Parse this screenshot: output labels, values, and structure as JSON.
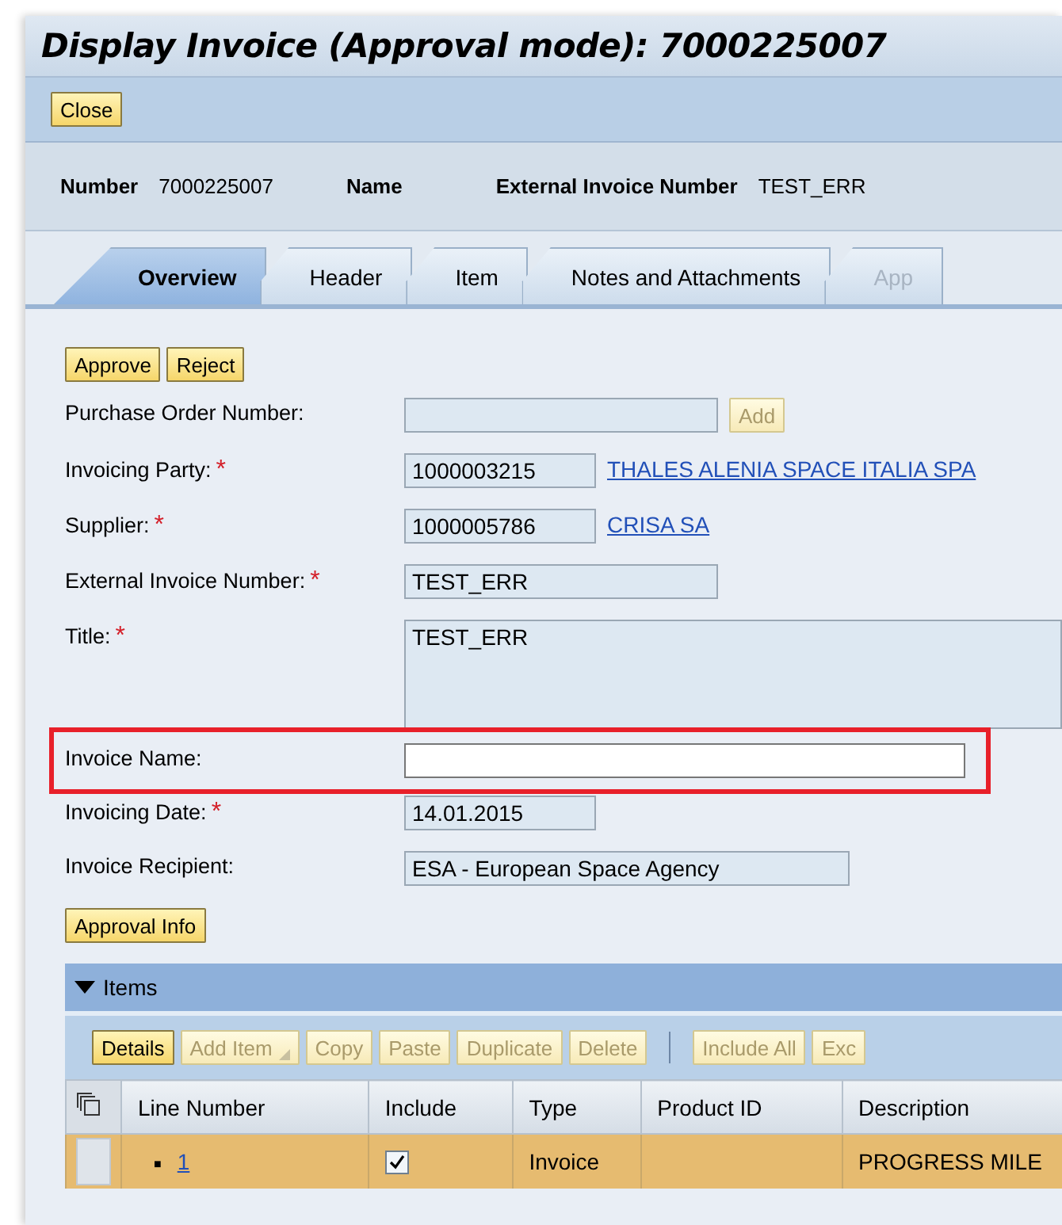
{
  "window": {
    "title": "Display Invoice (Approval mode): 7000225007"
  },
  "toolbar": {
    "buttons": [
      "Close"
    ]
  },
  "header_info": [
    {
      "label": "Number",
      "value": "7000225007"
    },
    {
      "label": "Name"
    },
    {
      "label": "External Invoice Number",
      "value": "TEST_ERR"
    }
  ],
  "tabs": [
    {
      "label": "Overview",
      "selected": true,
      "disabled": false
    },
    {
      "label": "Header",
      "selected": false,
      "disabled": false
    },
    {
      "label": "Item",
      "selected": false,
      "disabled": false
    },
    {
      "label": "Notes and Attachments",
      "selected": false,
      "disabled": false
    },
    {
      "label": "App",
      "selected": false,
      "disabled": true
    }
  ],
  "actions": [
    "Approve",
    "Reject"
  ],
  "form": [
    {
      "label": "Purchase Order Number:",
      "kind": "input",
      "button": "Add",
      "button_disabled": true
    },
    {
      "label": "Invoicing Party:",
      "required_mark": "*",
      "kind": "input",
      "value": "1000003215",
      "link": "THALES ALENIA SPACE ITALIA SPA"
    },
    {
      "label": "Supplier:",
      "required_mark": "*",
      "kind": "input",
      "value": "1000005786",
      "link": "CRISA SA"
    },
    {
      "label": "External Invoice Number:",
      "required_mark": "*",
      "kind": "input",
      "value": "TEST_ERR"
    },
    {
      "label": "Title:",
      "required_mark": "*",
      "kind": "textarea",
      "value": "TEST_ERR"
    },
    {
      "label": "Invoice Name:",
      "kind": "input",
      "editable": true,
      "highlighted": true
    },
    {
      "label": "Invoicing Date:",
      "required_mark": "*",
      "kind": "input",
      "value": "14.01.2015"
    },
    {
      "label": "Invoice Recipient:",
      "kind": "input",
      "value": "ESA - European Space Agency"
    }
  ],
  "approval_info_button": "Approval Info",
  "items": {
    "title": "Items",
    "expanded": true,
    "toolbar": [
      {
        "label": "Details",
        "disabled": false
      },
      {
        "label": "Add Item",
        "disabled": true,
        "menu": true
      },
      {
        "label": "Copy",
        "disabled": true
      },
      {
        "label": "Paste",
        "disabled": true
      },
      {
        "label": "Duplicate",
        "disabled": true
      },
      {
        "label": "Delete",
        "disabled": true
      },
      {
        "label": "Include All",
        "disabled": true,
        "separator_before": true
      },
      {
        "label": "Exc",
        "disabled": true
      }
    ],
    "columns": [
      "Line Number",
      "Include",
      "Type",
      "Product ID",
      "Description"
    ],
    "rows": [
      {
        "selected": true,
        "bullet": "■",
        "line_number": "1",
        "include": true,
        "type": "Invoice",
        "description": "PROGRESS MILE"
      }
    ]
  }
}
